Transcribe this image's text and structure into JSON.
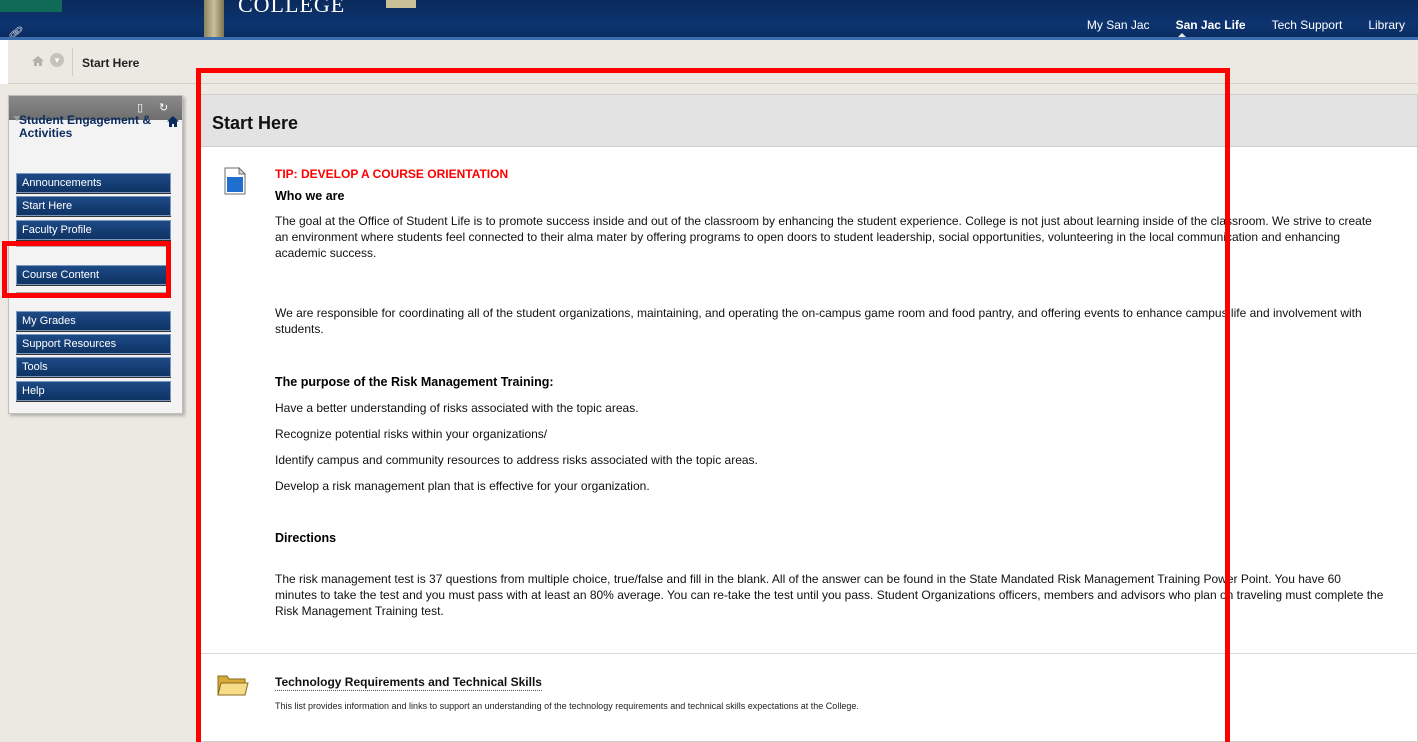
{
  "header": {
    "college_text": "COLLEGE",
    "nav": [
      "My San Jac",
      "San Jac Life",
      "Tech Support",
      "Library"
    ],
    "active": "San Jac Life"
  },
  "breadcrumb": {
    "current": "Start Here"
  },
  "menu": {
    "title": "Student Engagement & Activities",
    "items": [
      "Announcements",
      "Start Here",
      "Faculty Profile",
      "Course Content",
      "My Grades",
      "Support Resources",
      "Tools",
      "Help"
    ]
  },
  "page": {
    "title": "Start Here",
    "tip": "TIP: DEVELOP A COURSE ORIENTATION",
    "who_heading": "Who we are",
    "who_p1": "The goal at the Office of Student Life is to promote success inside and out of the classroom by enhancing the student experience.  College is not just about learning inside of the classroom.  We strive to create an environment where students feel connected to their alma mater by offering programs to open doors to student leadership, social opportunities, volunteering in the local communication and enhancing academic success.",
    "who_p2": "We are responsible for coordinating all of the student organizations, maintaining, and operating the on-campus game room and food pantry, and offering events to enhance campus life and involvement with students.",
    "purpose_heading": "The purpose of the Risk Management Training:",
    "purpose_items": [
      "Have a better understanding of risks associated with the topic areas.",
      "Recognize potential risks within your organizations/",
      "Identify campus and community resources to address risks associated with the topic areas.",
      "Develop a risk management plan that is effective for your organization."
    ],
    "directions_heading": "Directions",
    "directions_p": "The risk management test is 37 questions from multiple choice, true/false and fill in the blank.  All of the answer can be found in the State Mandated Risk Management Training Power Point.  You have 60 minutes to take the test and you must pass with at least an 80% average.  You can re-take the test until you pass.  Student Organizations officers, members and advisors who plan on traveling must complete the Risk Management Training test.",
    "tech_title": "Technology Requirements and Technical Skills",
    "tech_desc": "This list provides information and links to support an understanding of the technology requirements and technical skills expectations at the College."
  },
  "colors": {
    "nav_bg": "#0d3470",
    "menu_button": "#1d4a86",
    "annotation": "#ff0000",
    "tip": "#ff0000"
  }
}
